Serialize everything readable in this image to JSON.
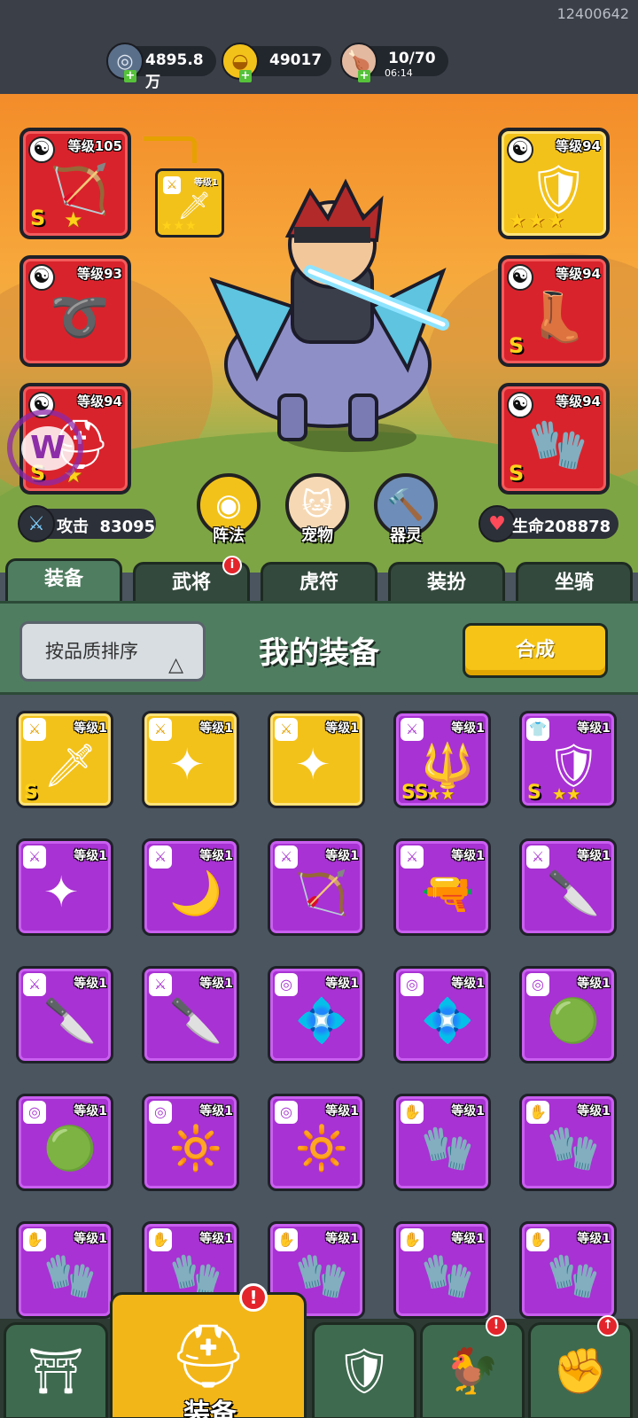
{
  "header": {
    "uid": "12400642",
    "silver": {
      "icon": "silver-coin-icon",
      "value": "4895.8万"
    },
    "gold": {
      "icon": "gold-ingot-icon",
      "value": "49017"
    },
    "stamina": {
      "icon": "meat-leg-icon",
      "value": "10/70",
      "timer": "06:14"
    }
  },
  "hero": {
    "left_slots": [
      {
        "level": "等级105",
        "grade": "S",
        "stars": "★",
        "icon": "crossbow-icon",
        "color": "red"
      },
      {
        "level": "等级93",
        "grade": "",
        "stars": "",
        "icon": "bow-icon",
        "color": "red"
      },
      {
        "level": "等级94",
        "grade": "S",
        "stars": "★",
        "icon": "helmet-icon",
        "color": "red"
      }
    ],
    "right_slots": [
      {
        "level": "等级94",
        "grade": "",
        "stars": "★★★",
        "icon": "armor-icon",
        "color": "gold"
      },
      {
        "level": "等级94",
        "grade": "S",
        "stars": "",
        "icon": "boots-icon",
        "color": "red"
      },
      {
        "level": "等级94",
        "grade": "S",
        "stars": "",
        "icon": "gauntlet-icon",
        "color": "red"
      }
    ],
    "linked_item": {
      "level": "等级1",
      "stars": "★★★",
      "icon": "ice-sword-icon"
    },
    "attack": {
      "label": "攻击",
      "value": "83095"
    },
    "life": {
      "label": "生命",
      "value": "208878"
    },
    "features": [
      {
        "label": "阵法",
        "icon": "formation-icon"
      },
      {
        "label": "宠物",
        "icon": "pet-cat-icon"
      },
      {
        "label": "器灵",
        "icon": "spirit-icon"
      }
    ]
  },
  "tabs": [
    {
      "label": "装备",
      "active": true,
      "badge": ""
    },
    {
      "label": "武将",
      "active": false,
      "badge": "i"
    },
    {
      "label": "虎符",
      "active": false,
      "badge": ""
    },
    {
      "label": "装扮",
      "active": false,
      "badge": ""
    },
    {
      "label": "坐骑",
      "active": false,
      "badge": ""
    }
  ],
  "panel": {
    "sort_label": "按品质排序",
    "sort_arrow": "△",
    "title": "我的装备",
    "merge_label": "合成"
  },
  "inventory": [
    {
      "level": "等级1",
      "grade": "S",
      "stars": "",
      "item": "ice-sword",
      "type": "weapon",
      "quality": "gold"
    },
    {
      "level": "等级1",
      "grade": "",
      "stars": "",
      "item": "shuriken",
      "type": "weapon",
      "quality": "gold"
    },
    {
      "level": "等级1",
      "grade": "",
      "stars": "",
      "item": "shuriken",
      "type": "weapon",
      "quality": "gold"
    },
    {
      "level": "等级1",
      "grade": "SS",
      "stars": "★★",
      "item": "trident",
      "type": "weapon",
      "quality": "purple"
    },
    {
      "level": "等级1",
      "grade": "S",
      "stars": "★★",
      "item": "armor",
      "type": "armor",
      "quality": "purple"
    },
    {
      "level": "等级1",
      "grade": "",
      "stars": "",
      "item": "shuriken",
      "type": "weapon",
      "quality": "purple"
    },
    {
      "level": "等级1",
      "grade": "",
      "stars": "",
      "item": "scimitar",
      "type": "weapon",
      "quality": "purple"
    },
    {
      "level": "等级1",
      "grade": "",
      "stars": "",
      "item": "crossbow",
      "type": "weapon",
      "quality": "purple"
    },
    {
      "level": "等级1",
      "grade": "",
      "stars": "",
      "item": "gun",
      "type": "weapon",
      "quality": "purple"
    },
    {
      "level": "等级1",
      "grade": "",
      "stars": "",
      "item": "glaive",
      "type": "weapon",
      "quality": "purple"
    },
    {
      "level": "等级1",
      "grade": "",
      "stars": "",
      "item": "glaive",
      "type": "weapon",
      "quality": "purple"
    },
    {
      "level": "等级1",
      "grade": "",
      "stars": "",
      "item": "glaive",
      "type": "weapon",
      "quality": "purple"
    },
    {
      "level": "等级1",
      "grade": "",
      "stars": "",
      "item": "amulet-blue",
      "type": "necklace",
      "quality": "purple"
    },
    {
      "level": "等级1",
      "grade": "",
      "stars": "",
      "item": "amulet-blue",
      "type": "necklace",
      "quality": "purple"
    },
    {
      "level": "等级1",
      "grade": "",
      "stars": "",
      "item": "amulet-green",
      "type": "necklace",
      "quality": "purple"
    },
    {
      "level": "等级1",
      "grade": "",
      "stars": "",
      "item": "amulet-green",
      "type": "necklace",
      "quality": "purple"
    },
    {
      "level": "等级1",
      "grade": "",
      "stars": "",
      "item": "amulet-gold",
      "type": "necklace",
      "quality": "purple"
    },
    {
      "level": "等级1",
      "grade": "",
      "stars": "",
      "item": "amulet-gold",
      "type": "necklace",
      "quality": "purple"
    },
    {
      "level": "等级1",
      "grade": "",
      "stars": "",
      "item": "gauntlet",
      "type": "glove",
      "quality": "purple"
    },
    {
      "level": "等级1",
      "grade": "",
      "stars": "",
      "item": "gauntlet",
      "type": "glove",
      "quality": "purple"
    },
    {
      "level": "等级1",
      "grade": "",
      "stars": "",
      "item": "gauntlet",
      "type": "glove",
      "quality": "purple"
    },
    {
      "level": "等级1",
      "grade": "",
      "stars": "",
      "item": "gauntlet",
      "type": "glove",
      "quality": "purple"
    },
    {
      "level": "等级1",
      "grade": "",
      "stars": "",
      "item": "gauntlet",
      "type": "glove",
      "quality": "purple"
    },
    {
      "level": "等级1",
      "grade": "",
      "stars": "",
      "item": "gauntlet",
      "type": "glove",
      "quality": "purple"
    },
    {
      "level": "等级1",
      "grade": "",
      "stars": "",
      "item": "gauntlet",
      "type": "glove",
      "quality": "purple"
    }
  ],
  "bottom_nav": [
    {
      "icon": "shop-gate-icon",
      "label": "",
      "alert": ""
    },
    {
      "icon": "helmet-icon",
      "label": "装备",
      "alert": "!"
    },
    {
      "icon": "battle-shield-icon",
      "label": "",
      "alert": ""
    },
    {
      "icon": "rooster-icon",
      "label": "",
      "alert": "!"
    },
    {
      "icon": "fist-upgrade-icon",
      "label": "",
      "alert": "↑"
    }
  ],
  "colors": {
    "accent_green": "#4f7d60",
    "gold_button": "#f5c417",
    "purple_quality": "#a832d3",
    "gold_quality": "#f3c21a",
    "red_slot": "#d9232c"
  }
}
